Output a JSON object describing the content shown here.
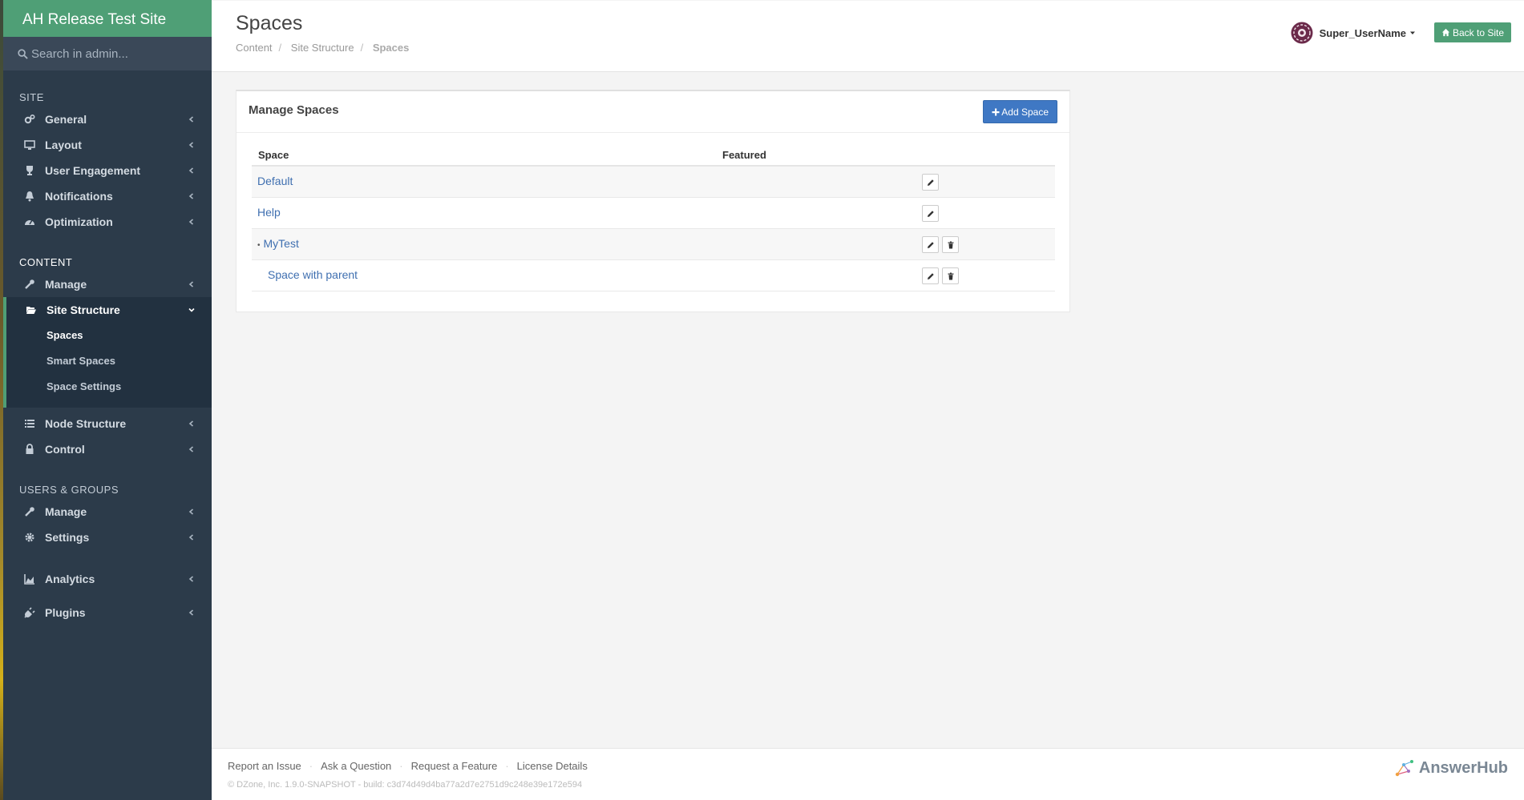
{
  "sidebar": {
    "brand": "AH Release Test Site",
    "search_placeholder": "Search in admin...",
    "sections": {
      "site": "SITE",
      "content": "CONTENT",
      "users": "USERS & GROUPS"
    },
    "site_items": [
      "General",
      "Layout",
      "User Engagement",
      "Notifications",
      "Optimization"
    ],
    "content_items": {
      "manage": "Manage",
      "site_structure": "Site Structure",
      "spaces": "Spaces",
      "smart_spaces": "Smart Spaces",
      "space_settings": "Space Settings",
      "node_structure": "Node Structure",
      "control": "Control"
    },
    "users_items": [
      "Manage",
      "Settings"
    ],
    "analytics": "Analytics",
    "plugins": "Plugins"
  },
  "header": {
    "title": "Spaces",
    "breadcrumb": [
      "Content",
      "Site Structure",
      "Spaces"
    ],
    "user_name": "Super_UserName",
    "back_label": "Back to Site"
  },
  "panel": {
    "title": "Manage Spaces",
    "add_label": "Add Space",
    "columns": [
      "Space",
      "Featured"
    ],
    "rows": [
      {
        "name": "Default",
        "indent": 0,
        "bullet": "",
        "delete": false
      },
      {
        "name": "Help",
        "indent": 0,
        "bullet": "",
        "delete": false
      },
      {
        "name": "MyTest",
        "indent": 0,
        "bullet": "•",
        "delete": true
      },
      {
        "name": "Space with parent",
        "indent": 1,
        "bullet": "",
        "delete": true
      }
    ]
  },
  "footer": {
    "links": [
      "Report an Issue",
      "Ask a Question",
      "Request a Feature",
      "License Details"
    ],
    "copyright": "© DZone, Inc. 1.9.0-SNAPSHOT - build: c3d74d49d4ba77a2d7e2751d9c248e39e172e594",
    "logo_text": "AnswerHub"
  },
  "colors": {
    "sidebar_bg": "#2c3b4a",
    "brand_green": "#4f9f76",
    "primary_blue": "#3f78c4",
    "link_blue": "#3f6fb0"
  }
}
